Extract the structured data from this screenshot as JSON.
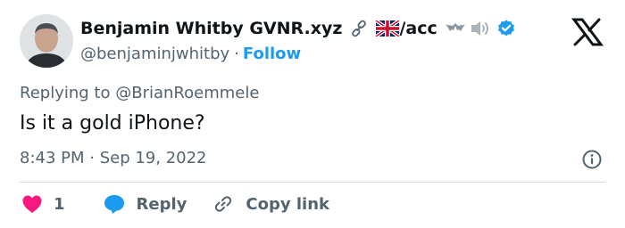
{
  "author": {
    "name": "Benjamin Whitby GVNR.xyz",
    "name_suffix": "/acc",
    "handle": "@benjaminjwhitby",
    "separator": "·",
    "follow_label": "Follow"
  },
  "tweet": {
    "replying_prefix": "Replying to",
    "replying_to": "@BrianRoemmele",
    "text": "Is it a gold iPhone?",
    "timestamp": "8:43 PM · Sep 19, 2022"
  },
  "actions": {
    "like_count": "1",
    "reply_label": "Reply",
    "copy_link_label": "Copy link"
  },
  "colors": {
    "accent": "#1d9bf0",
    "like": "#f91880",
    "text_primary": "#0f1419",
    "text_secondary": "#536471"
  },
  "icons": {
    "link": "link-icon",
    "flag": "uk-flag-icon",
    "bat": "bat-icon",
    "speaker": "speaker-icon",
    "verified": "verified-badge-icon",
    "logo": "x-logo-icon",
    "info": "info-icon",
    "heart": "heart-icon",
    "reply": "reply-bubble-icon",
    "copy": "copy-link-icon"
  }
}
